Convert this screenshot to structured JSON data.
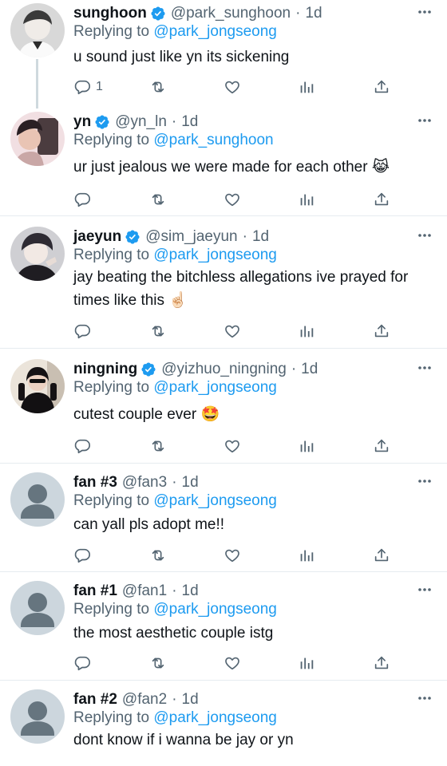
{
  "tweets": [
    {
      "name": "sunghoon",
      "verified": true,
      "handle": "@park_sunghoon",
      "time": "1d",
      "replying_prefix": "Replying to ",
      "replying_to": "@park_jongseong",
      "text": "u sound just like yn its sickening",
      "reply_count": "1",
      "avatar": "photo"
    },
    {
      "name": "yn",
      "verified": true,
      "handle": "@yn_ln",
      "time": "1d",
      "replying_prefix": "Replying to ",
      "replying_to": "@park_sunghoon",
      "text": "ur just jealous we were made for each other 😹",
      "reply_count": "",
      "avatar": "photo"
    },
    {
      "name": "jaeyun",
      "verified": true,
      "handle": "@sim_jaeyun",
      "time": "1d",
      "replying_prefix": "Replying to ",
      "replying_to": "@park_jongseong",
      "text": "jay beating the bitchless allegations ive prayed for times like this ☝🏻",
      "reply_count": "",
      "avatar": "photo"
    },
    {
      "name": "ningning",
      "verified": true,
      "handle": "@yizhuo_ningning",
      "time": "1d",
      "replying_prefix": "Replying to ",
      "replying_to": "@park_jongseong",
      "text": "cutest couple ever 🤩",
      "reply_count": "",
      "avatar": "photo"
    },
    {
      "name": "fan #3",
      "verified": false,
      "handle": "@fan3",
      "time": "1d",
      "replying_prefix": "Replying to ",
      "replying_to": "@park_jongseong",
      "text": "can yall pls adopt me!!",
      "reply_count": "",
      "avatar": "default"
    },
    {
      "name": "fan #1",
      "verified": false,
      "handle": "@fan1",
      "time": "1d",
      "replying_prefix": "Replying to ",
      "replying_to": "@park_jongseong",
      "text": "the most aesthetic couple istg",
      "reply_count": "",
      "avatar": "default"
    },
    {
      "name": "fan #2",
      "verified": false,
      "handle": "@fan2",
      "time": "1d",
      "replying_prefix": "Replying to ",
      "replying_to": "@park_jongseong",
      "text": "dont know if i wanna be jay or yn",
      "reply_count": "",
      "avatar": "default"
    }
  ],
  "separator": "·",
  "icons": [
    "more-icon",
    "reply-icon",
    "retweet-icon",
    "like-icon",
    "analytics-icon",
    "share-icon",
    "verified-icon"
  ],
  "colors": {
    "link": "#1d9bf0",
    "muted": "#536471",
    "divider": "#e6ecf0",
    "verified": "#1d9bf0"
  }
}
